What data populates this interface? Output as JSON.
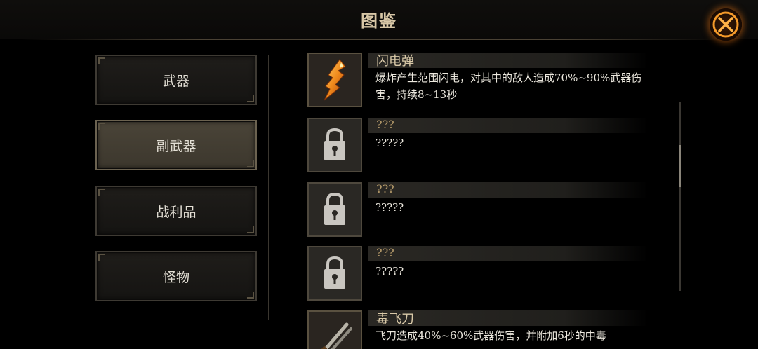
{
  "header": {
    "title": "图鉴"
  },
  "menu": {
    "items": [
      {
        "label": "武器",
        "active": false
      },
      {
        "label": "副武器",
        "active": true
      },
      {
        "label": "战利品",
        "active": false
      },
      {
        "label": "怪物",
        "active": false
      }
    ]
  },
  "entries": [
    {
      "title": "闪电弹",
      "desc": "爆炸产生范围闪电，对其中的敌人造成70%~90%武器伤害，持续8~13秒",
      "icon": "lightning-bomb-icon",
      "locked": false
    },
    {
      "title": "???",
      "desc": "?????",
      "icon": "lock-icon",
      "locked": true
    },
    {
      "title": "???",
      "desc": "?????",
      "icon": "lock-icon",
      "locked": true
    },
    {
      "title": "???",
      "desc": "?????",
      "icon": "lock-icon",
      "locked": true
    },
    {
      "title": "毒飞刀",
      "desc": "飞刀造成40%~60%武器伤害，并附加6秒的中毒",
      "icon": "poison-knife-icon",
      "locked": false
    }
  ],
  "colors": {
    "accent": "#f07814",
    "title_gold": "#d7c6a6",
    "locked_title": "#b59a6a",
    "active_tab": "#4a4438"
  }
}
